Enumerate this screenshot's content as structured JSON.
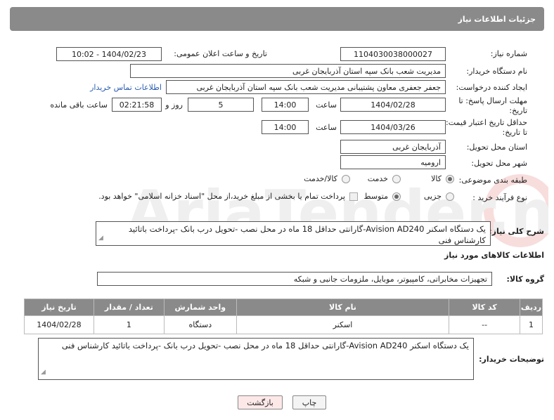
{
  "header": {
    "title": "جزئیات اطلاعات نیاز"
  },
  "fields": {
    "need_number_label": "شماره نیاز:",
    "need_number": "1104030038000027",
    "announce_label": "تاریخ و ساعت اعلان عمومی:",
    "announce_value": "1404/02/23 - 10:02",
    "buyer_label": "نام دستگاه خریدار:",
    "buyer_value": "مدیریت شعب بانک سپه استان آذربایجان غربی",
    "creator_label": "ایجاد کننده درخواست:",
    "creator_value": "جعفر جعفری معاون پشتیبانی مدیریت شعب بانک سپه استان آذربایجان غربی",
    "contact_link": "اطلاعات تماس خریدار",
    "reply_deadline_label_1": "مهلت ارسال پاسخ: تا",
    "reply_deadline_label_2": "تاریخ:",
    "reply_date": "1404/02/28",
    "time_label": "ساعت",
    "reply_time": "14:00",
    "days_value": "5",
    "days_label": "روز و",
    "remaining_time": "02:21:58",
    "remaining_label": "ساعت باقی مانده",
    "price_deadline_label_1": "حداقل تاریخ اعتبار قیمت:",
    "price_deadline_label_2": "تا تاریخ:",
    "price_date": "1404/03/26",
    "price_time": "14:00",
    "province_label": "استان محل تحویل:",
    "province_value": "آذربایجان غربی",
    "city_label": "شهر محل تحویل:",
    "city_value": "ارومیه",
    "category_label": "طبقه بندی موضوعی:",
    "category_options": [
      "کالا",
      "خدمت",
      "کالا/خدمت"
    ],
    "process_label": "نوع فرآیند خرید :",
    "process_options": [
      "جزیی",
      "متوسط"
    ],
    "payment_note": "پرداخت تمام یا بخشی از مبلغ خرید،از محل \"اسناد خزانه اسلامی\" خواهد بود."
  },
  "description": {
    "label": "شرح کلی نیاز:",
    "text": "یک دستگاه اسکنر Avision AD240-گارانتی حداقل 18 ماه در محل نصب -تحویل درب بانک -پرداخت باتائید کارشناس فنی"
  },
  "goods_section": {
    "title": "اطلاعات کالاهای مورد نیاز",
    "group_label": "گروه کالا:",
    "group_value": "تجهیزات مخابراتی، کامپیوتر، موبایل، ملزومات جانبی و شبکه"
  },
  "table": {
    "headers": [
      "ردیف",
      "کد کالا",
      "نام کالا",
      "واحد شمارش",
      "تعداد / مقدار",
      "تاریخ نیاز"
    ],
    "rows": [
      [
        "1",
        "--",
        "اسکنر",
        "دستگاه",
        "1",
        "1404/02/28"
      ]
    ]
  },
  "buyer_notes": {
    "label": "توضیحات خریدار:",
    "text": "یک دستگاه اسکنر Avision AD240-گارانتی حداقل 18 ماه در محل نصب -تحویل درب بانک -پرداخت باتائید کارشناس فنی"
  },
  "buttons": {
    "print": "چاپ",
    "back": "بازگشت"
  },
  "watermark": "AriaTender.neT",
  "colors": {
    "header_bg": "#8a8a8a",
    "link": "#2a5db0",
    "back_button_bg": "#fde8e8"
  }
}
